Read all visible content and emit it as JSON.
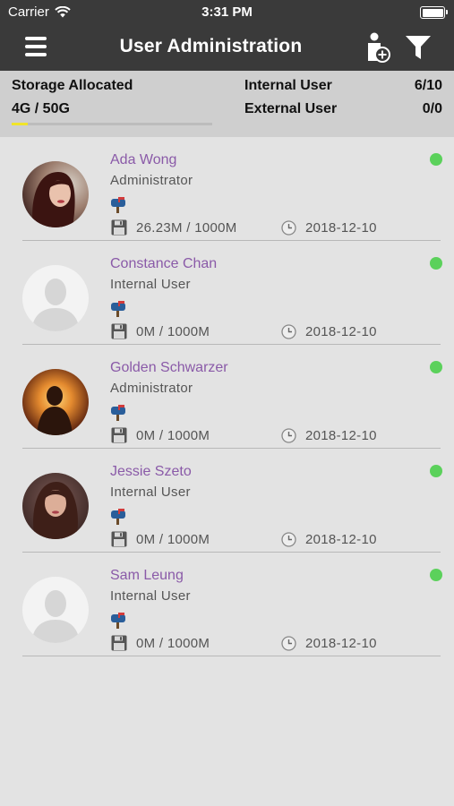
{
  "status_bar": {
    "carrier": "Carrier",
    "time": "3:31 PM"
  },
  "nav": {
    "title": "User Administration",
    "menu_icon": "hamburger-icon",
    "add_user_icon": "add-user-icon",
    "filter_icon": "filter-icon"
  },
  "summary": {
    "storage_label": "Storage Allocated",
    "storage_value": "4G / 50G",
    "storage_fraction": 0.08,
    "internal_label": "Internal User",
    "internal_value": "6/10",
    "external_label": "External User",
    "external_value": "0/0",
    "progress_color": "#f1e52a"
  },
  "users": [
    {
      "name": "Ada Wong",
      "role": "Administrator",
      "usage": "26.23M / 1000M",
      "date": "2018-12-10",
      "avatar": "photo-dark-hair",
      "online": true
    },
    {
      "name": "Constance Chan",
      "role": "Internal User",
      "usage": "0M / 1000M",
      "date": "2018-12-10",
      "avatar": "placeholder",
      "online": true
    },
    {
      "name": "Golden Schwarzer",
      "role": "Administrator",
      "usage": "0M / 1000M",
      "date": "2018-12-10",
      "avatar": "photo-sunset",
      "online": true
    },
    {
      "name": "Jessie Szeto",
      "role": "Internal User",
      "usage": "0M / 1000M",
      "date": "2018-12-10",
      "avatar": "photo-long-hair",
      "online": true
    },
    {
      "name": "Sam Leung",
      "role": "Internal User",
      "usage": "0M / 1000M",
      "date": "2018-12-10",
      "avatar": "placeholder",
      "online": true
    }
  ],
  "colors": {
    "header": "#3a3a3a",
    "name": "#8a5aa8",
    "online": "#5bd15b"
  }
}
